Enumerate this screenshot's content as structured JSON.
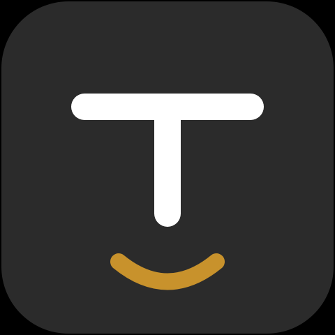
{
  "icon": {
    "name": "app-icon",
    "glyph": "t-letter-smile",
    "colors": {
      "page_background": "#000000",
      "tile_background": "#2b2b2b",
      "letter": "#ffffff",
      "smile": "#c8922c"
    }
  }
}
